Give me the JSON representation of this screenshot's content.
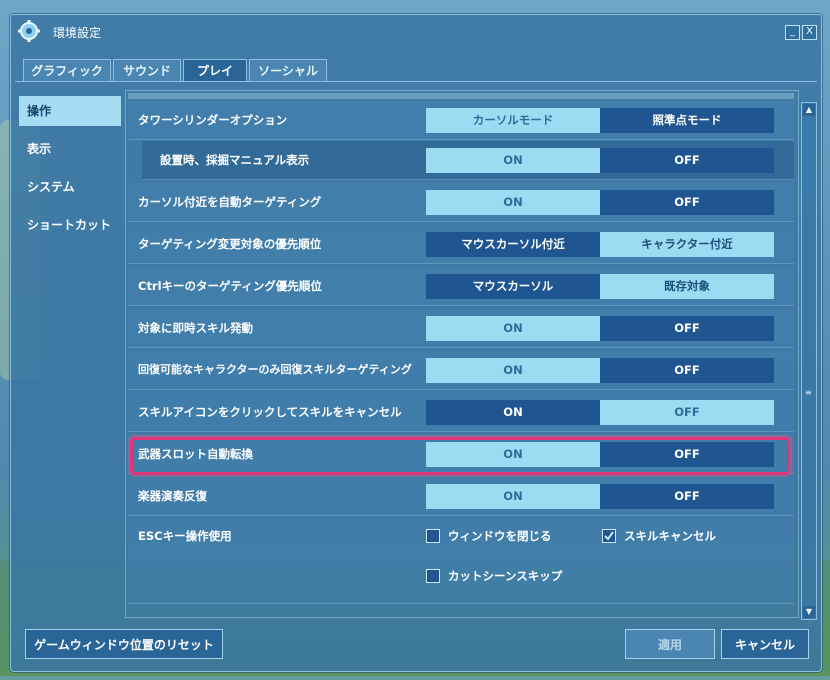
{
  "window": {
    "title": "環境設定",
    "minimize": "_",
    "close": "X"
  },
  "tabs": [
    {
      "label": "グラフィック"
    },
    {
      "label": "サウンド"
    },
    {
      "label": "プレイ"
    },
    {
      "label": "ソーシャル"
    }
  ],
  "sidebar": {
    "items": [
      {
        "label": "操作"
      },
      {
        "label": "表示"
      },
      {
        "label": "システム"
      },
      {
        "label": "ショートカット"
      }
    ]
  },
  "settings": [
    {
      "label": "タワーシリンダーオプション",
      "options": [
        "カーソルモード",
        "照準点モード"
      ],
      "selected": 1
    },
    {
      "label": "設置時、採掘マニュアル表示",
      "options": [
        "ON",
        "OFF"
      ],
      "selected": 1
    },
    {
      "label": "カーソル付近を自動ターゲティング",
      "options": [
        "ON",
        "OFF"
      ],
      "selected": 1
    },
    {
      "label": "ターゲティング変更対象の優先順位",
      "options": [
        "マウスカーソル付近",
        "キャラクター付近"
      ],
      "selected": 0
    },
    {
      "label": "Ctrlキーのターゲティング優先順位",
      "options": [
        "マウスカーソル",
        "既存対象"
      ],
      "selected": 0
    },
    {
      "label": "対象に即時スキル発動",
      "options": [
        "ON",
        "OFF"
      ],
      "selected": 1
    },
    {
      "label": "回復可能なキャラクターのみ回復スキルターゲティング",
      "options": [
        "ON",
        "OFF"
      ],
      "selected": 1
    },
    {
      "label": "スキルアイコンをクリックしてスキルをキャンセル",
      "options": [
        "ON",
        "OFF"
      ],
      "selected": 0
    },
    {
      "label": "武器スロット自動転換",
      "options": [
        "ON",
        "OFF"
      ],
      "selected": 1
    },
    {
      "label": "楽器演奏反復",
      "options": [
        "ON",
        "OFF"
      ],
      "selected": 1
    }
  ],
  "esc": {
    "label": "ESCキー操作使用",
    "checks": [
      {
        "label": "ウィンドウを閉じる",
        "checked": "false"
      },
      {
        "label": "スキルキャンセル",
        "checked": "true"
      },
      {
        "label": "カットシーンスキップ",
        "checked": "false"
      }
    ]
  },
  "footer": {
    "reset": "ゲームウィンドウ位置のリセット",
    "apply": "適用",
    "cancel": "キャンセル"
  },
  "scroll": {
    "up": "▲",
    "down": "▼",
    "grip": "≡"
  },
  "colors": {
    "selected": "#1f5590",
    "unselected": "#9cdcf3",
    "highlight": "#e0357a"
  }
}
